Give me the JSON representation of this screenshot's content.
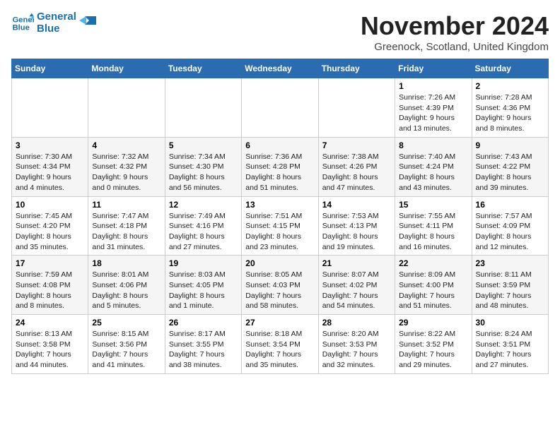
{
  "logo": {
    "line1": "General",
    "line2": "Blue"
  },
  "title": "November 2024",
  "subtitle": "Greenock, Scotland, United Kingdom",
  "weekdays": [
    "Sunday",
    "Monday",
    "Tuesday",
    "Wednesday",
    "Thursday",
    "Friday",
    "Saturday"
  ],
  "weeks": [
    [
      {
        "day": "",
        "info": ""
      },
      {
        "day": "",
        "info": ""
      },
      {
        "day": "",
        "info": ""
      },
      {
        "day": "",
        "info": ""
      },
      {
        "day": "",
        "info": ""
      },
      {
        "day": "1",
        "info": "Sunrise: 7:26 AM\nSunset: 4:39 PM\nDaylight: 9 hours and 13 minutes."
      },
      {
        "day": "2",
        "info": "Sunrise: 7:28 AM\nSunset: 4:36 PM\nDaylight: 9 hours and 8 minutes."
      }
    ],
    [
      {
        "day": "3",
        "info": "Sunrise: 7:30 AM\nSunset: 4:34 PM\nDaylight: 9 hours and 4 minutes."
      },
      {
        "day": "4",
        "info": "Sunrise: 7:32 AM\nSunset: 4:32 PM\nDaylight: 9 hours and 0 minutes."
      },
      {
        "day": "5",
        "info": "Sunrise: 7:34 AM\nSunset: 4:30 PM\nDaylight: 8 hours and 56 minutes."
      },
      {
        "day": "6",
        "info": "Sunrise: 7:36 AM\nSunset: 4:28 PM\nDaylight: 8 hours and 51 minutes."
      },
      {
        "day": "7",
        "info": "Sunrise: 7:38 AM\nSunset: 4:26 PM\nDaylight: 8 hours and 47 minutes."
      },
      {
        "day": "8",
        "info": "Sunrise: 7:40 AM\nSunset: 4:24 PM\nDaylight: 8 hours and 43 minutes."
      },
      {
        "day": "9",
        "info": "Sunrise: 7:43 AM\nSunset: 4:22 PM\nDaylight: 8 hours and 39 minutes."
      }
    ],
    [
      {
        "day": "10",
        "info": "Sunrise: 7:45 AM\nSunset: 4:20 PM\nDaylight: 8 hours and 35 minutes."
      },
      {
        "day": "11",
        "info": "Sunrise: 7:47 AM\nSunset: 4:18 PM\nDaylight: 8 hours and 31 minutes."
      },
      {
        "day": "12",
        "info": "Sunrise: 7:49 AM\nSunset: 4:16 PM\nDaylight: 8 hours and 27 minutes."
      },
      {
        "day": "13",
        "info": "Sunrise: 7:51 AM\nSunset: 4:15 PM\nDaylight: 8 hours and 23 minutes."
      },
      {
        "day": "14",
        "info": "Sunrise: 7:53 AM\nSunset: 4:13 PM\nDaylight: 8 hours and 19 minutes."
      },
      {
        "day": "15",
        "info": "Sunrise: 7:55 AM\nSunset: 4:11 PM\nDaylight: 8 hours and 16 minutes."
      },
      {
        "day": "16",
        "info": "Sunrise: 7:57 AM\nSunset: 4:09 PM\nDaylight: 8 hours and 12 minutes."
      }
    ],
    [
      {
        "day": "17",
        "info": "Sunrise: 7:59 AM\nSunset: 4:08 PM\nDaylight: 8 hours and 8 minutes."
      },
      {
        "day": "18",
        "info": "Sunrise: 8:01 AM\nSunset: 4:06 PM\nDaylight: 8 hours and 5 minutes."
      },
      {
        "day": "19",
        "info": "Sunrise: 8:03 AM\nSunset: 4:05 PM\nDaylight: 8 hours and 1 minute."
      },
      {
        "day": "20",
        "info": "Sunrise: 8:05 AM\nSunset: 4:03 PM\nDaylight: 7 hours and 58 minutes."
      },
      {
        "day": "21",
        "info": "Sunrise: 8:07 AM\nSunset: 4:02 PM\nDaylight: 7 hours and 54 minutes."
      },
      {
        "day": "22",
        "info": "Sunrise: 8:09 AM\nSunset: 4:00 PM\nDaylight: 7 hours and 51 minutes."
      },
      {
        "day": "23",
        "info": "Sunrise: 8:11 AM\nSunset: 3:59 PM\nDaylight: 7 hours and 48 minutes."
      }
    ],
    [
      {
        "day": "24",
        "info": "Sunrise: 8:13 AM\nSunset: 3:58 PM\nDaylight: 7 hours and 44 minutes."
      },
      {
        "day": "25",
        "info": "Sunrise: 8:15 AM\nSunset: 3:56 PM\nDaylight: 7 hours and 41 minutes."
      },
      {
        "day": "26",
        "info": "Sunrise: 8:17 AM\nSunset: 3:55 PM\nDaylight: 7 hours and 38 minutes."
      },
      {
        "day": "27",
        "info": "Sunrise: 8:18 AM\nSunset: 3:54 PM\nDaylight: 7 hours and 35 minutes."
      },
      {
        "day": "28",
        "info": "Sunrise: 8:20 AM\nSunset: 3:53 PM\nDaylight: 7 hours and 32 minutes."
      },
      {
        "day": "29",
        "info": "Sunrise: 8:22 AM\nSunset: 3:52 PM\nDaylight: 7 hours and 29 minutes."
      },
      {
        "day": "30",
        "info": "Sunrise: 8:24 AM\nSunset: 3:51 PM\nDaylight: 7 hours and 27 minutes."
      }
    ]
  ]
}
